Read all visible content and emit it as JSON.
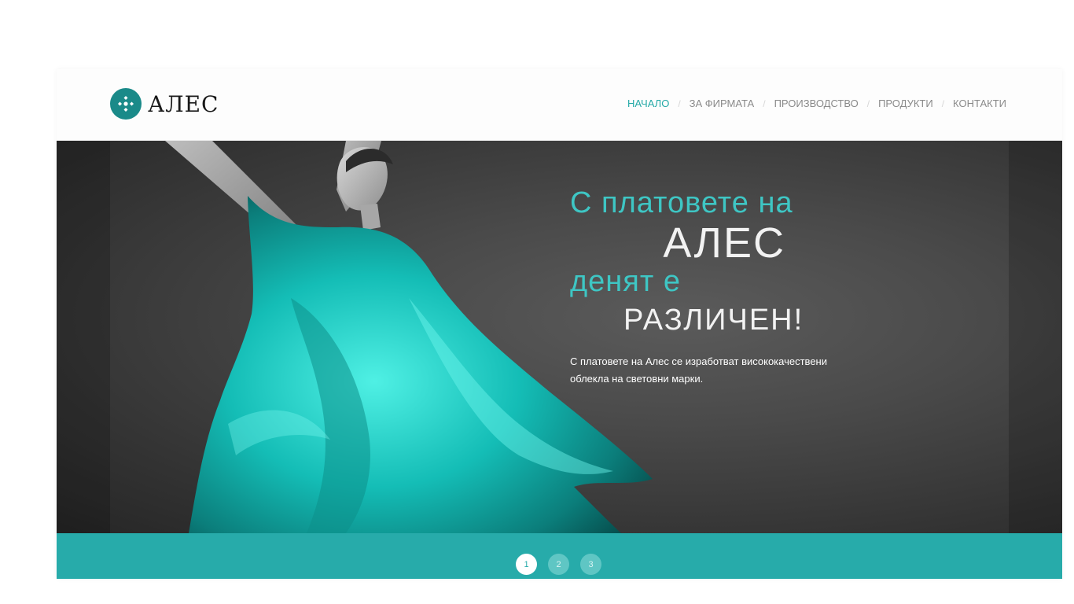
{
  "brand": {
    "name": "АЛЕС",
    "accent_color": "#25a9a7",
    "logo_icon": "diamond-dots-icon"
  },
  "nav": {
    "items": [
      {
        "label": "НАЧАЛО",
        "active": true
      },
      {
        "label": "ЗА ФИРМАТА",
        "active": false
      },
      {
        "label": "ПРОИЗВОДСТВО",
        "active": false
      },
      {
        "label": "ПРОДУКТИ",
        "active": false
      },
      {
        "label": "КОНТАКТИ",
        "active": false
      }
    ],
    "separator": "/"
  },
  "hero": {
    "line1": "С платовете на",
    "line2": "АЛЕС",
    "line3": "денят е",
    "line4": "РАЗЛИЧЕН!",
    "description": "С платовете на Алес се изработват висококачествени облекла на световни марки."
  },
  "slider": {
    "pages": [
      "1",
      "2",
      "3"
    ],
    "current": "1",
    "bar_color": "#27abaa"
  }
}
